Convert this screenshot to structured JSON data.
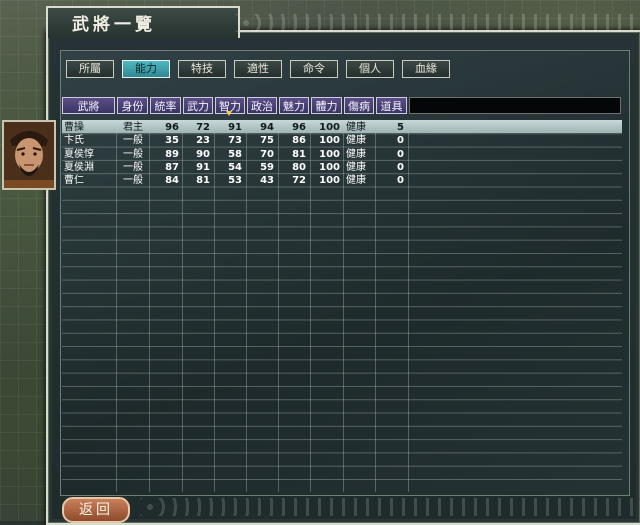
{
  "window": {
    "title": "武將一覽"
  },
  "tabs": [
    {
      "label": "所屬",
      "active": false
    },
    {
      "label": "能力",
      "active": true
    },
    {
      "label": "特技",
      "active": false
    },
    {
      "label": "適性",
      "active": false
    },
    {
      "label": "命令",
      "active": false
    },
    {
      "label": "個人",
      "active": false
    },
    {
      "label": "血緣",
      "active": false
    }
  ],
  "table": {
    "columns": [
      "武將",
      "身份",
      "統率",
      "武力",
      "智力",
      "政治",
      "魅力",
      "體力",
      "傷病",
      "道具"
    ],
    "sorted_column": "智力",
    "rows": [
      [
        "曹操",
        "君主",
        "96",
        "72",
        "91",
        "94",
        "96",
        "100",
        "健康",
        "5"
      ],
      [
        "卞氏",
        "一般",
        "35",
        "23",
        "73",
        "75",
        "86",
        "100",
        "健康",
        "0"
      ],
      [
        "夏侯惇",
        "一般",
        "89",
        "90",
        "58",
        "70",
        "81",
        "100",
        "健康",
        "0"
      ],
      [
        "夏侯淵",
        "一般",
        "87",
        "91",
        "54",
        "59",
        "80",
        "100",
        "健康",
        "0"
      ],
      [
        "曹仁",
        "一般",
        "84",
        "81",
        "53",
        "43",
        "72",
        "100",
        "健康",
        "0"
      ]
    ],
    "selected_row": 0
  },
  "footer": {
    "return_label": "返回"
  },
  "colors": {
    "active_tab": "#4fb8c2",
    "header_bg": "#5a4f86",
    "selected_row": "#c6d8d8",
    "button_return": "#c8805a"
  }
}
